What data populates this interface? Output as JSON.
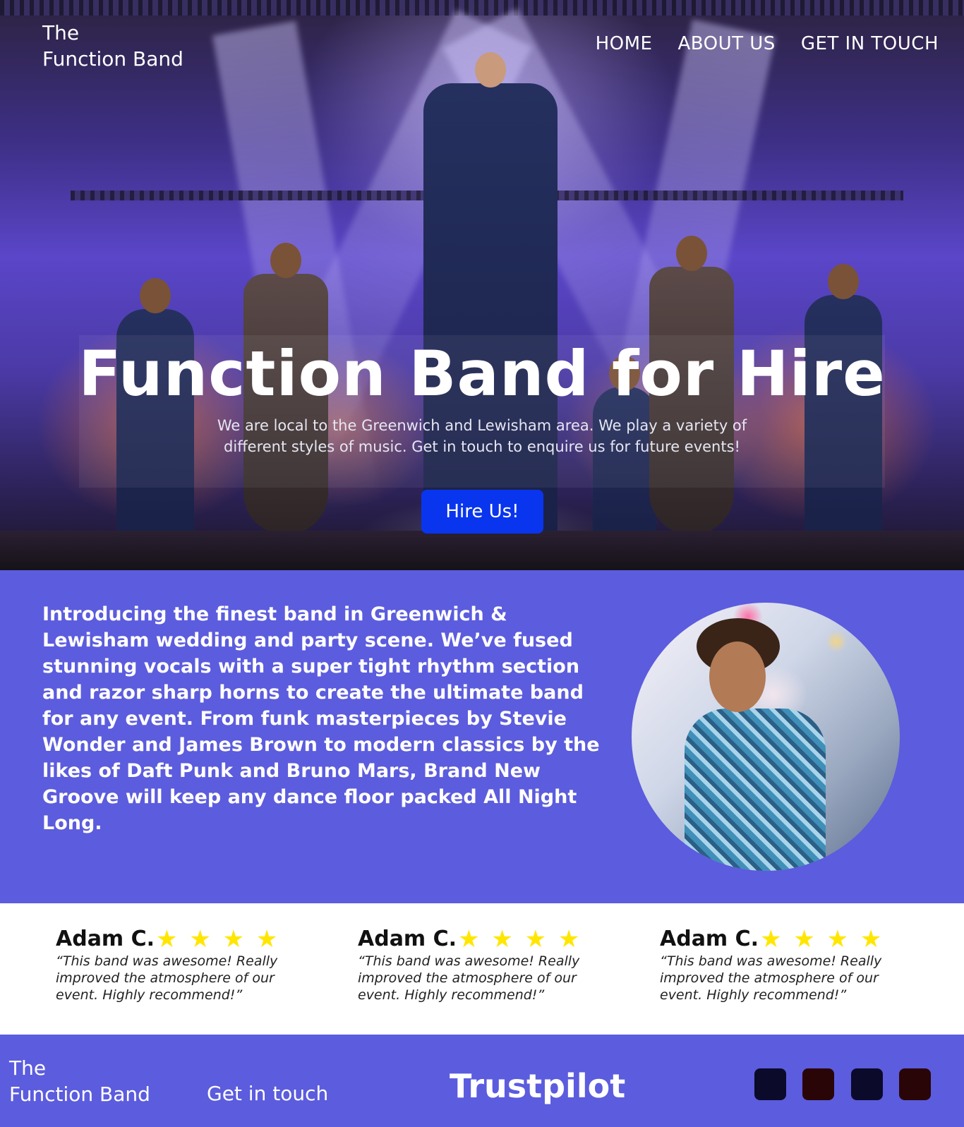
{
  "header": {
    "brand_line1": "The",
    "brand_line2": "Function Band",
    "nav": [
      {
        "label": "HOME"
      },
      {
        "label": "ABOUT US"
      },
      {
        "label": "GET IN TOUCH"
      }
    ]
  },
  "hero": {
    "title": "Function Band for Hire",
    "subtitle": "We are local to the Greenwich and Lewisham area. We play a variety of different styles of music. Get in touch to enquire us for future events!",
    "cta_label": "Hire Us!",
    "cta_color": "#0a35ee"
  },
  "about": {
    "text": "Introducing the finest band in Greenwich & Lewisham wedding and party scene. We’ve fused stunning vocals with a super tight rhythm section and razor sharp horns to create the ultimate band for any event. From funk masterpieces by Stevie Wonder and James Brown to modern classics by the likes of Daft Punk and Bruno Mars, Brand New Groove will keep any dance floor packed All Night Long.",
    "background": "#5c5cde"
  },
  "reviews": [
    {
      "name": "Adam C.",
      "stars": "★ ★ ★ ★",
      "rating": 4,
      "quote": "“This band was awesome! Really improved the atmosphere of our event. Highly recommend!”"
    },
    {
      "name": "Adam C.",
      "stars": "★ ★ ★ ★",
      "rating": 4,
      "quote": "“This band was awesome! Really improved the atmosphere of our event. Highly recommend!”"
    },
    {
      "name": "Adam C.",
      "stars": "★ ★ ★ ★",
      "rating": 4,
      "quote": "“This band was awesome! Really improved the atmosphere of our event. Highly recommend!”"
    }
  ],
  "footer": {
    "brand_line1": "The",
    "brand_line2": "Function Band",
    "contact_link": "Get in touch",
    "trustpilot": "Trustpilot",
    "social_icons": [
      {
        "icon": "social-icon-1",
        "color": "#0b0a2a"
      },
      {
        "icon": "social-icon-2",
        "color": "#2a0508"
      },
      {
        "icon": "social-icon-3",
        "color": "#0b0a2a"
      },
      {
        "icon": "social-icon-4",
        "color": "#2a0508"
      }
    ]
  },
  "colors": {
    "accent": "#5c5cde",
    "star": "#ffe600"
  }
}
